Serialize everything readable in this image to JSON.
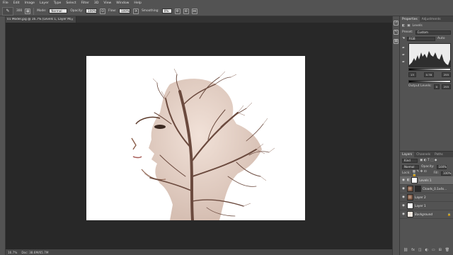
{
  "menu": [
    "File",
    "Edit",
    "Image",
    "Layer",
    "Type",
    "Select",
    "Filter",
    "3D",
    "View",
    "Window",
    "Help"
  ],
  "options": {
    "brush_size": "300",
    "mode_label": "Mode:",
    "mode_value": "Normal",
    "opacity_label": "Opacity:",
    "opacity_value": "100%",
    "flow_label": "Flow:",
    "flow_value": "100%",
    "smoothing_label": "Smoothing:",
    "smoothing_value": "0%"
  },
  "document": {
    "tab_title": "01 Model.jpg @ 16.7% (Levels 1, Layer Mask/8) *",
    "zoom": "16.7%",
    "doc_size": "Doc: 38.6M/65.7M"
  },
  "properties": {
    "tabs": [
      "Properties",
      "Adjustments"
    ],
    "title": "Levels",
    "preset_label": "Preset:",
    "preset_value": "Custom",
    "channel": "RGB",
    "auto": "Auto",
    "input_values": [
      "13",
      "0.78",
      "255"
    ],
    "output_label": "Output Levels:",
    "output_values": [
      "0",
      "255"
    ]
  },
  "layers": {
    "tabs": [
      "Layers",
      "Channels",
      "Paths"
    ],
    "kind": "Kind",
    "blend": "Normal",
    "opacity_label": "Opacity:",
    "opacity_value": "100%",
    "lock_label": "Lock:",
    "fill_label": "Fill:",
    "fill_value": "100%",
    "items": [
      {
        "name": "Levels 1"
      },
      {
        "name": "Cloads_0.1x4s..."
      },
      {
        "name": "Layer 2"
      },
      {
        "name": "Layer 1"
      },
      {
        "name": "Background"
      }
    ]
  }
}
